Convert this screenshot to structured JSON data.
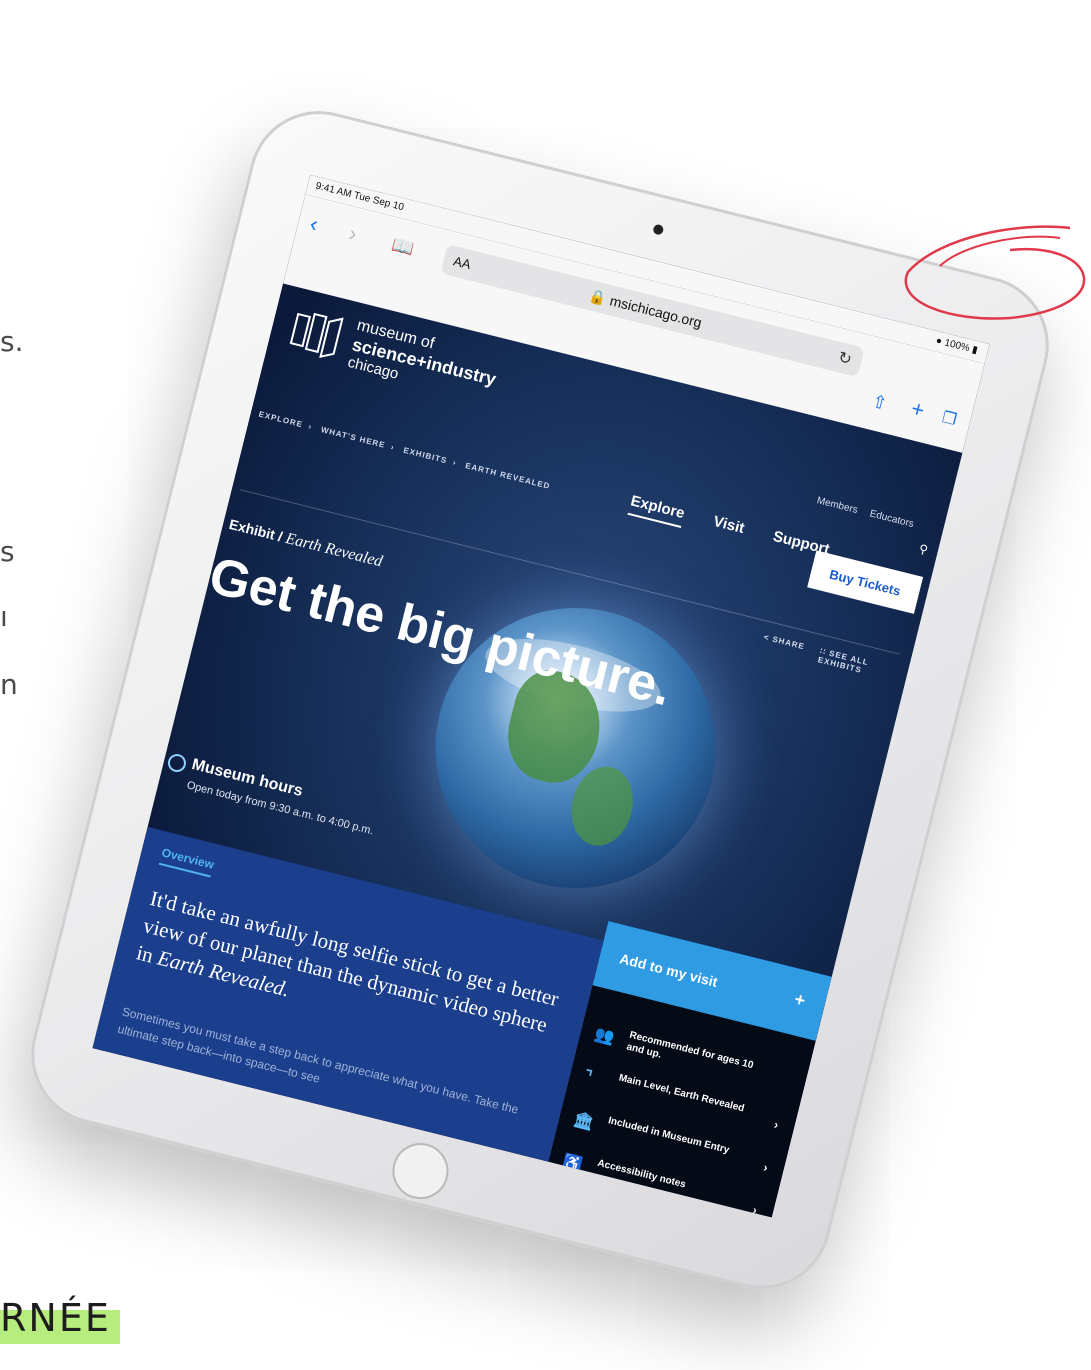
{
  "margin_texts": [
    "s.",
    "s",
    "ı",
    "n"
  ],
  "footer_text": "RNÉE",
  "status": {
    "time": "9:41 AM  Tue Sep 10",
    "battery": "100%"
  },
  "browser": {
    "reader_label": "AA",
    "url": "msichicago.org"
  },
  "site": {
    "logo": {
      "line1": "museum of",
      "line2": "science+industry",
      "line3": "chicago"
    },
    "util_links": [
      "Members",
      "Educators"
    ],
    "nav": [
      {
        "label": "Explore",
        "active": true
      },
      {
        "label": "Visit"
      },
      {
        "label": "Support"
      }
    ],
    "buy_tickets": "Buy Tickets",
    "breadcrumb": [
      "EXPLORE",
      "WHAT'S HERE",
      "EXHIBITS",
      "EARTH REVEALED"
    ],
    "share": "SHARE",
    "see_all": "SEE ALL EXHIBITS",
    "exhibit_prefix": "Exhibit / ",
    "exhibit_name": "Earth Revealed",
    "headline": "Get the big picture.",
    "hours_title": "Museum hours",
    "hours_text": "Open today from 9:30 a.m. to 4:00 p.m.",
    "overview_tab": "Overview",
    "lede_main": "It'd take an awfully long selfie stick to get a better view of our planet than the dynamic video sphere in ",
    "lede_em": "Earth Revealed.",
    "body": "Sometimes you must take a step back to appreciate what you have. Take the ultimate step back—into space—to see",
    "add_to_visit": "Add to my visit",
    "add_plus": "+",
    "sidebar": [
      {
        "label": "Recommended for ages 10 and up.",
        "icon": "people-icon"
      },
      {
        "label": "Main Level, Earth Revealed",
        "icon": "stairs-icon"
      },
      {
        "label": "Included in Museum Entry",
        "icon": "museum-icon"
      },
      {
        "label": "Accessibility notes",
        "icon": "accessibility-icon"
      }
    ]
  },
  "colors": {
    "accent": "#2e9be3",
    "site_bg": "#0c1a3a",
    "content_bg": "#1b3f8c",
    "annotation": "#e0394a"
  }
}
